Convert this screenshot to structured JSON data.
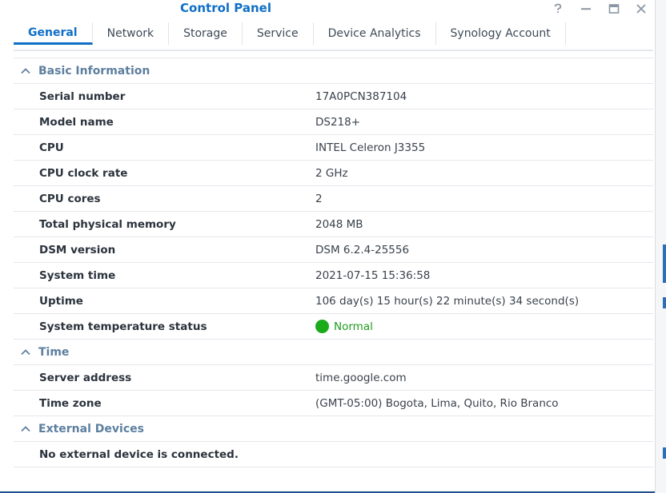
{
  "window": {
    "title": "Control Panel"
  },
  "tabs": [
    {
      "label": "General",
      "active": true
    },
    {
      "label": "Network",
      "active": false
    },
    {
      "label": "Storage",
      "active": false
    },
    {
      "label": "Service",
      "active": false
    },
    {
      "label": "Device Analytics",
      "active": false
    },
    {
      "label": "Synology Account",
      "active": false
    }
  ],
  "sections": {
    "basic": {
      "title": "Basic Information",
      "rows": [
        {
          "label": "Serial number",
          "value": "17A0PCN387104"
        },
        {
          "label": "Model name",
          "value": "DS218+"
        },
        {
          "label": "CPU",
          "value": "INTEL Celeron J3355"
        },
        {
          "label": "CPU clock rate",
          "value": "2 GHz"
        },
        {
          "label": "CPU cores",
          "value": "2"
        },
        {
          "label": "Total physical memory",
          "value": "2048 MB"
        },
        {
          "label": "DSM version",
          "value": "DSM 6.2.4-25556"
        },
        {
          "label": "System time",
          "value": "2021-07-15 15:36:58"
        },
        {
          "label": "Uptime",
          "value": "106 day(s) 15 hour(s) 22 minute(s) 34 second(s)"
        },
        {
          "label": "System temperature status",
          "value": "Normal"
        }
      ]
    },
    "time": {
      "title": "Time",
      "rows": [
        {
          "label": "Server address",
          "value": "time.google.com"
        },
        {
          "label": "Time zone",
          "value": "(GMT-05:00) Bogota, Lima, Quito, Rio Branco"
        }
      ]
    },
    "external": {
      "title": "External Devices",
      "note": "No external device is connected."
    }
  },
  "colors": {
    "accent": "#0f6fc6",
    "section_title": "#5d7f9f",
    "status_ok": "#1aaa1a"
  },
  "icons": {
    "help": "help-icon",
    "minimize": "minimize-icon",
    "maximize": "maximize-icon",
    "close": "close-icon",
    "section_toggle": "chevron-up-icon",
    "status": "status-dot-icon"
  }
}
